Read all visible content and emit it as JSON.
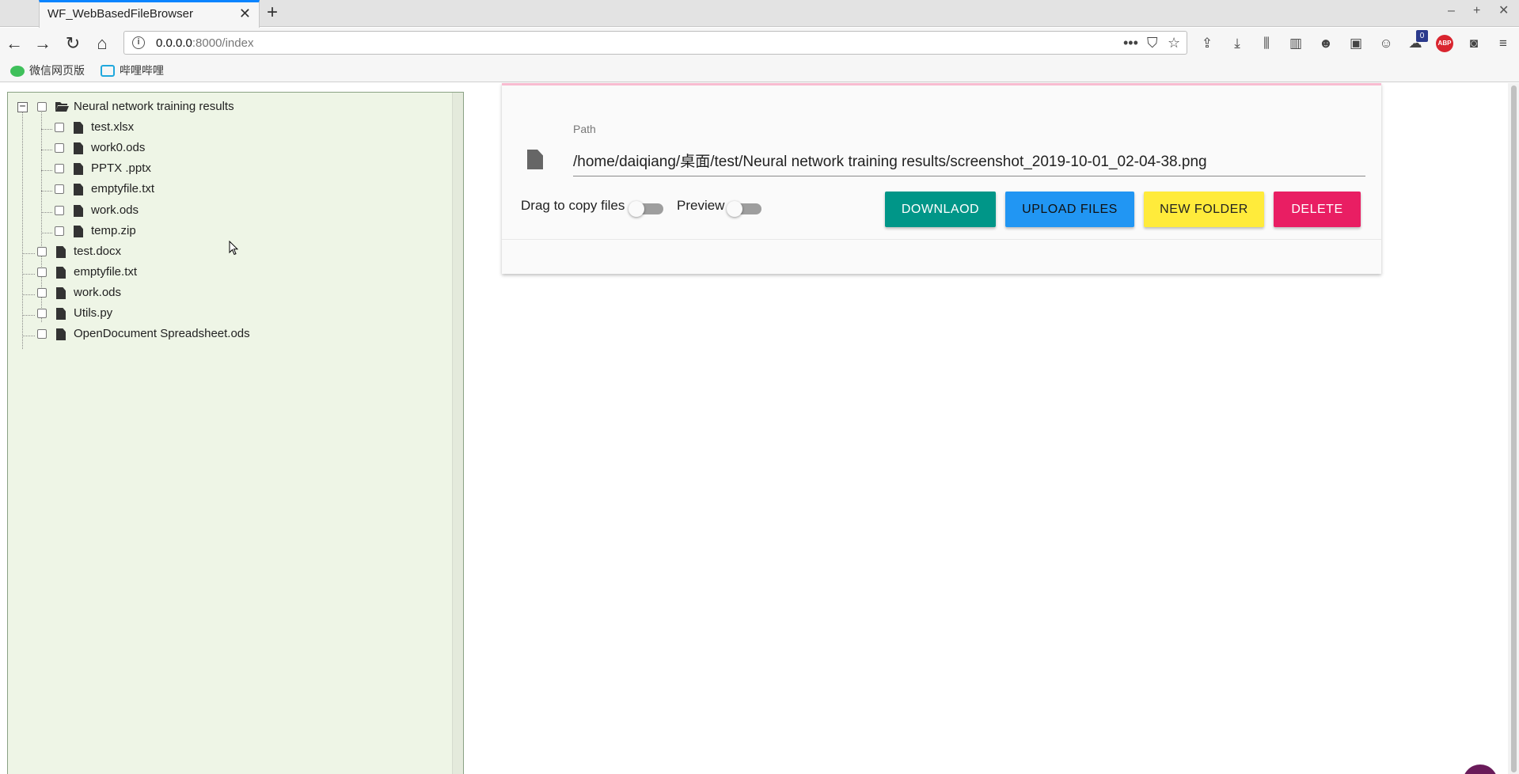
{
  "browser": {
    "tab_title": "WF_WebBasedFileBrowser",
    "url_host": "0.0.0.0",
    "url_path": ":8000/index",
    "badge_count": "0",
    "abp_label": "ABP",
    "bookmarks": [
      {
        "label": "微信网页版"
      },
      {
        "label": "哔哩哔哩"
      }
    ]
  },
  "tree": {
    "root": {
      "label": "Neural network training results"
    },
    "children": [
      {
        "label": "test.xlsx"
      },
      {
        "label": "work0.ods"
      },
      {
        "label": "PPTX .pptx"
      },
      {
        "label": "emptyfile.txt"
      },
      {
        "label": "work.ods"
      },
      {
        "label": "temp.zip"
      }
    ],
    "siblings": [
      {
        "label": "test.docx"
      },
      {
        "label": "emptyfile.txt"
      },
      {
        "label": "work.ods"
      },
      {
        "label": "Utils.py"
      },
      {
        "label": "OpenDocument Spreadsheet.ods"
      }
    ]
  },
  "panel": {
    "path_label": "Path",
    "path_value": "/home/daiqiang/桌面/test/Neural network training results/screenshot_2019-10-01_02-04-38.png",
    "drag_label": "Drag to copy files",
    "preview_label": "Preview",
    "buttons": {
      "download": "DOWNLAOD",
      "upload": "UPLOAD FILES",
      "new_folder": "NEW FOLDER",
      "delete": "DELETE"
    },
    "colors": {
      "download": "#009688",
      "upload": "#2196f3",
      "new_folder": "#ffeb3b",
      "delete": "#e91e63"
    }
  }
}
